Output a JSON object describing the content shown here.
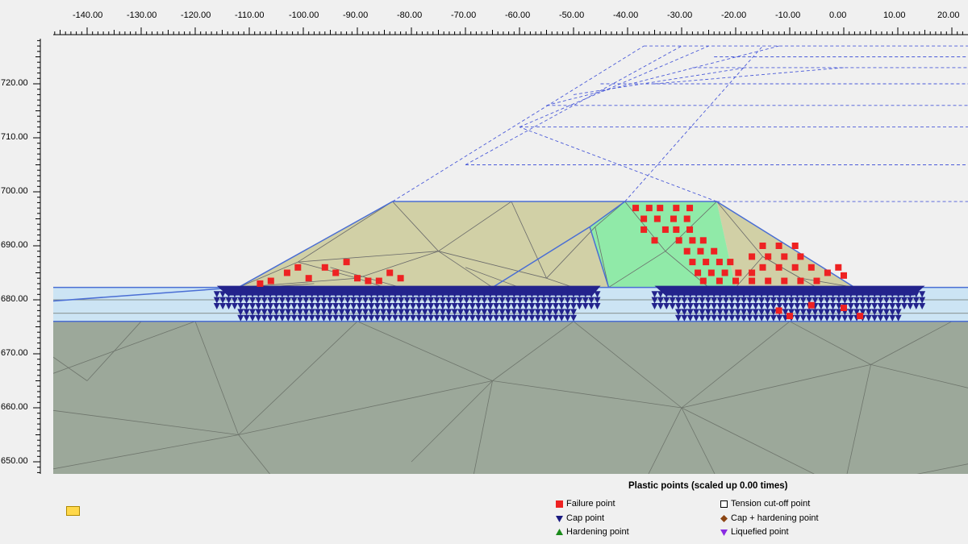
{
  "x_ticks": [
    "-140.00",
    "-130.00",
    "-120.00",
    "-110.00",
    "-100.00",
    "-90.00",
    "-80.00",
    "-70.00",
    "-60.00",
    "-50.00",
    "-40.00",
    "-30.00",
    "-20.00",
    "-10.00",
    "0.00",
    "10.00",
    "20.00"
  ],
  "y_ticks": [
    "720.00",
    "710.00",
    "700.00",
    "690.00",
    "680.00",
    "670.00",
    "660.00",
    "650.00"
  ],
  "legend": {
    "title": "Plastic points (scaled up 0.00 times)",
    "items": [
      {
        "label": "Failure point",
        "color": "#ee2222",
        "shape": "square"
      },
      {
        "label": "Tension cut-off point",
        "color": "#ffffff",
        "shape": "square-outline"
      },
      {
        "label": "Cap point",
        "color": "#1a1a80",
        "shape": "triangle-down"
      },
      {
        "label": "Cap + hardening point",
        "color": "#8b4513",
        "shape": "diamond"
      },
      {
        "label": "Hardening point",
        "color": "#1a8a1a",
        "shape": "triangle-up"
      },
      {
        "label": "Liquefied point",
        "color": "#8a2be2",
        "shape": "triangle-down"
      }
    ]
  },
  "colors": {
    "subsoil": "#9ca89a",
    "sand_layer": "#cce4f4",
    "embankment": "#d1d0a6",
    "core": "#90eaa8",
    "failure": "#ee2222",
    "cap": "#23238c",
    "boundary": "#4a6ed4"
  },
  "icons": {
    "status": "warning-icon"
  }
}
